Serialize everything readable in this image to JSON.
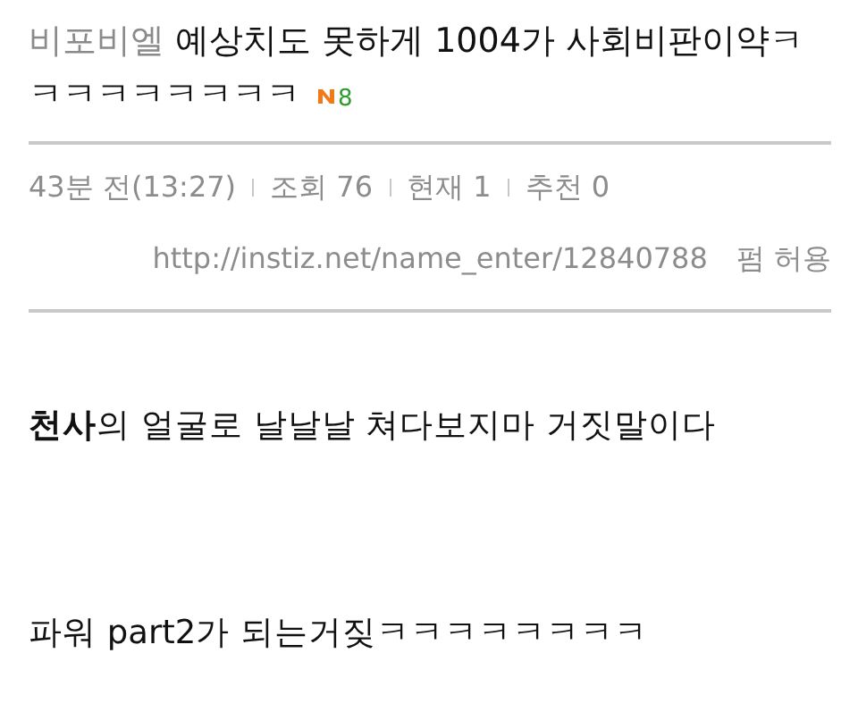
{
  "post": {
    "category": "비포비엘",
    "title_lines": [
      "예상치도 못하게 1004가 사회비판이약ㅋ",
      "ㅋㅋㅋㅋㅋㅋㅋㅋ"
    ],
    "new": true,
    "comment_count": "8",
    "meta": [
      "43분 전(13:27)",
      "조회 76",
      "현재 1",
      "추천 0"
    ],
    "url": "http://instiz.net/name_enter/12840788",
    "permission": "펌 허용",
    "body": [
      "**천사**의 얼굴로 날날날 쳐다보지마 거짓말이다",
      "파워 part2가 되는거짖ㅋㅋㅋㅋㅋㅋㅋㅋ"
    ]
  }
}
